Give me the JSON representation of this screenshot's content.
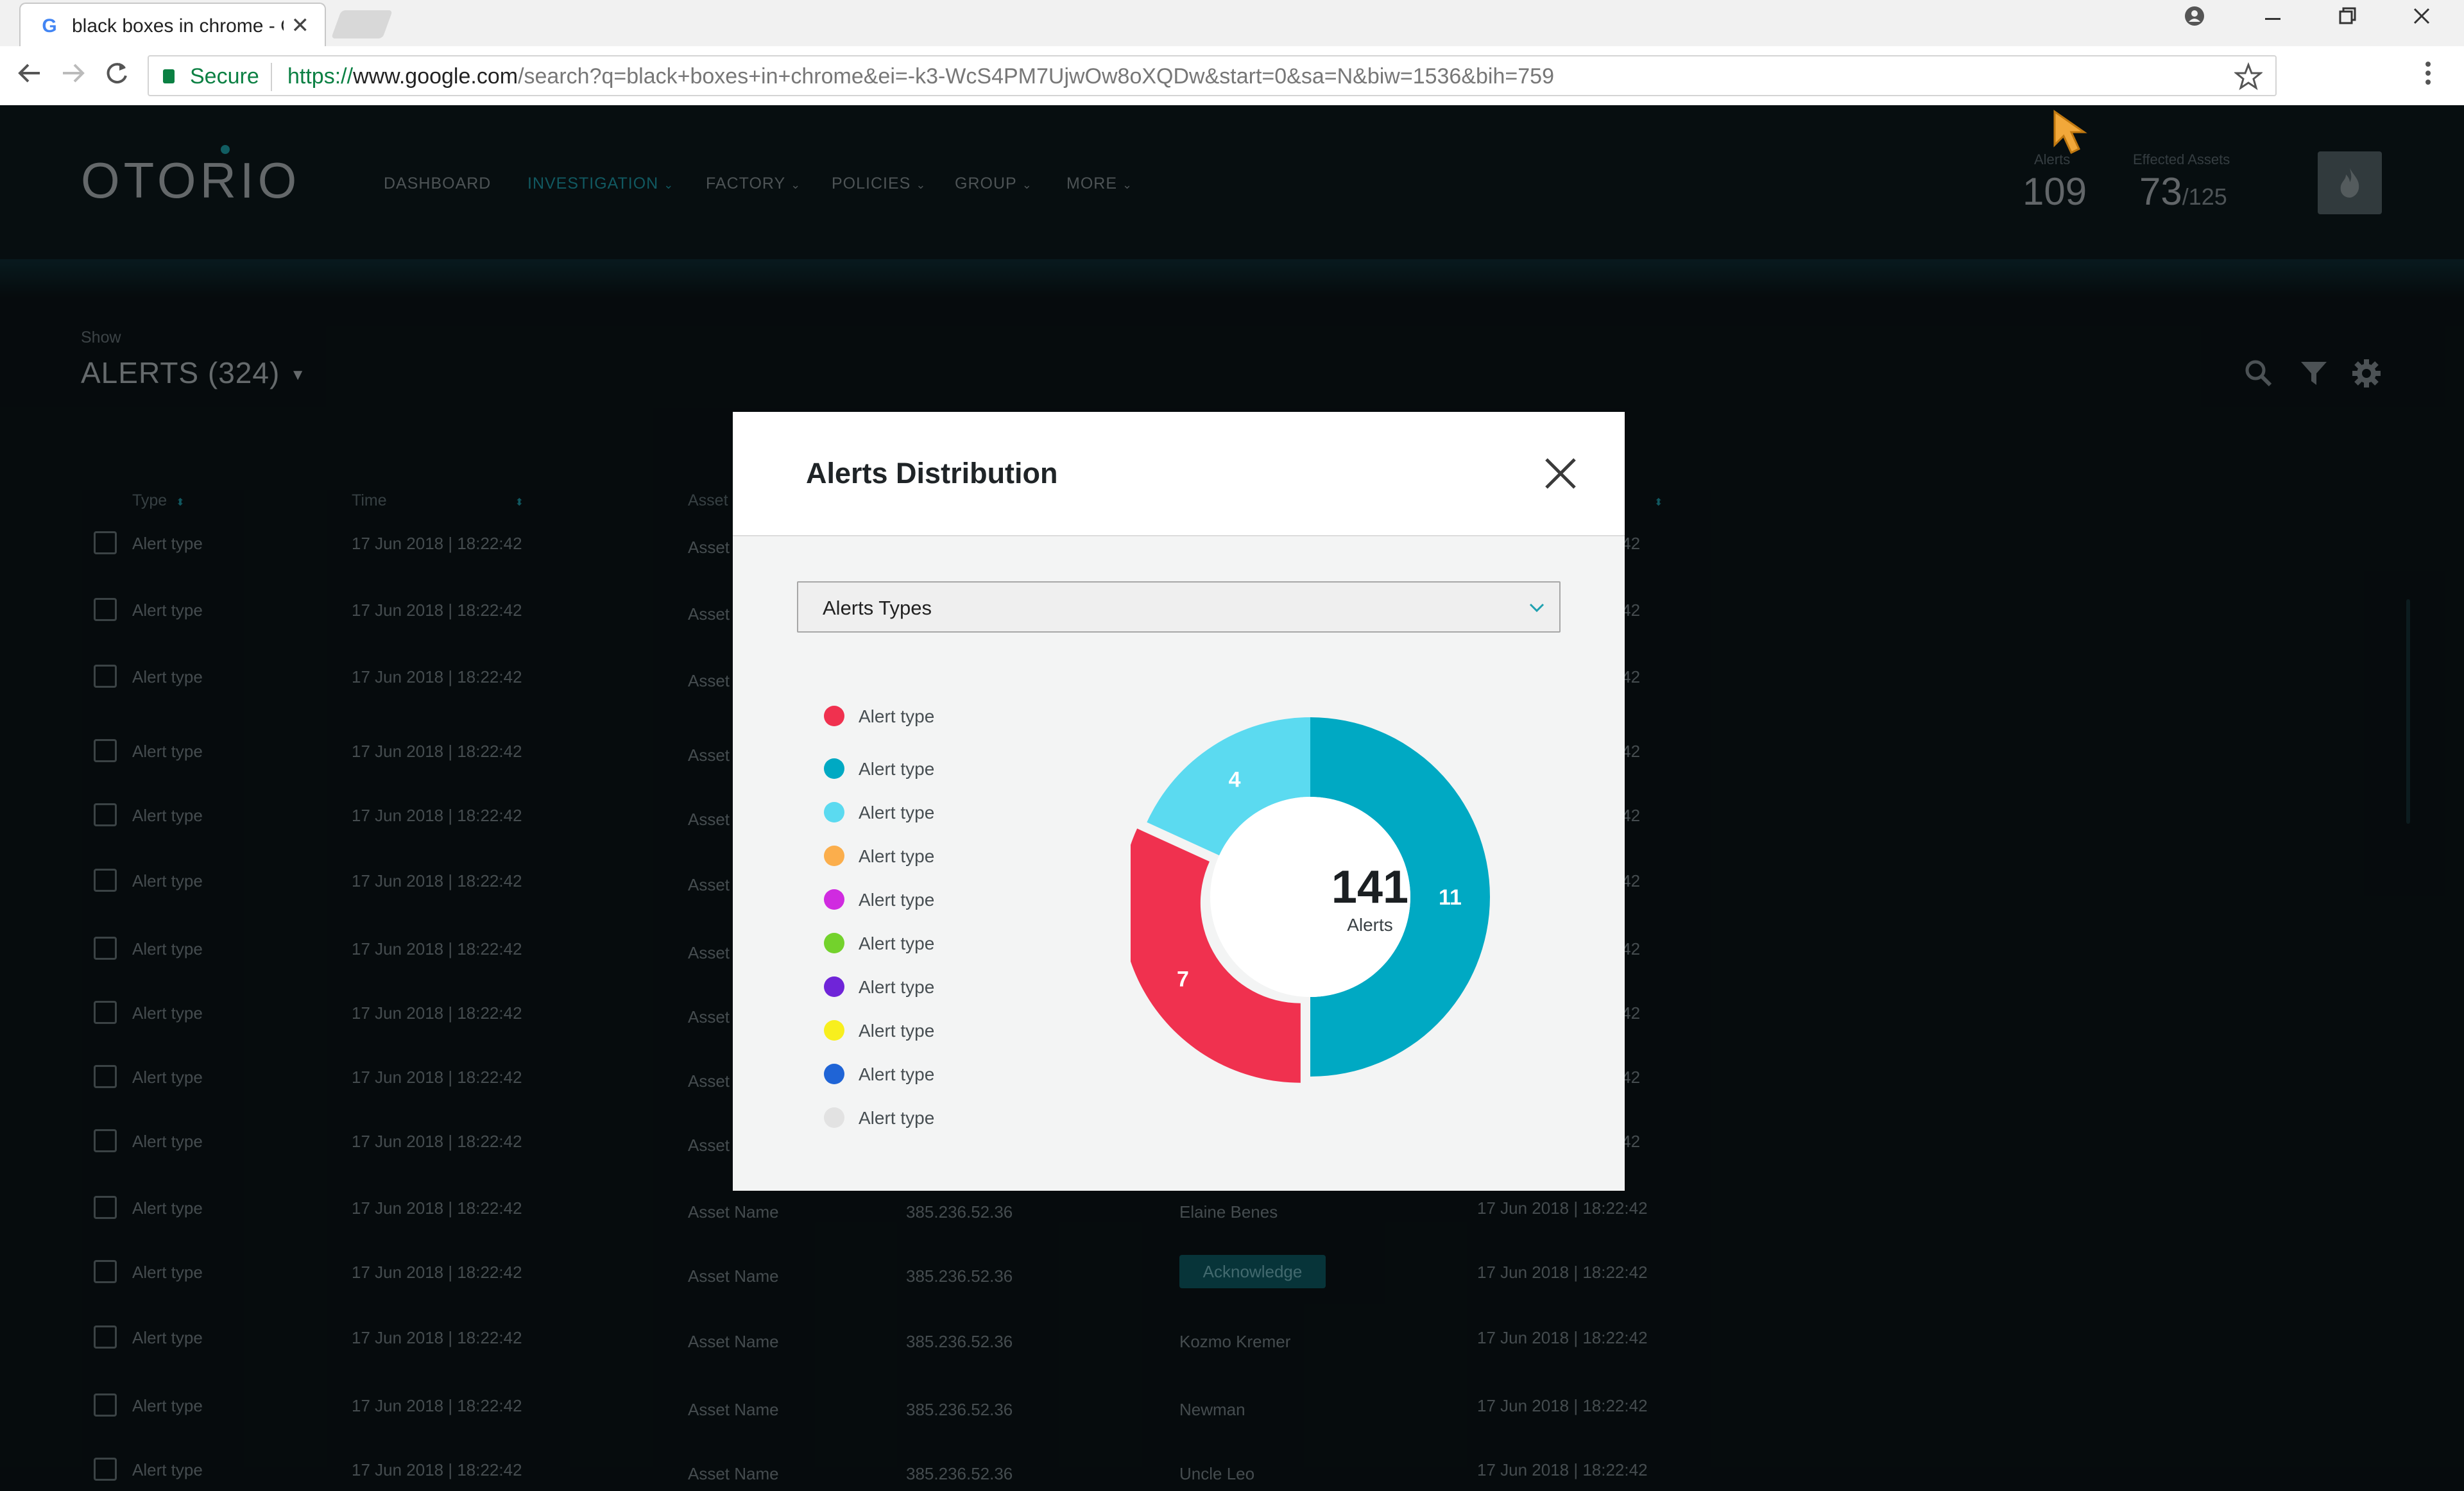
{
  "browser": {
    "tab_title": "black boxes in chrome - G",
    "favicon": "G",
    "tab_close": "✕",
    "secure_label": "Secure",
    "url_https": "https://",
    "url_domain": "www.google.com",
    "url_path": "/search?q=black+boxes+in+chrome&ei=-k3-WcS4PM7UjwOw8oXQDw&start=0&sa=N&biw=1536&bih=759",
    "icons": [
      "back-icon",
      "forward-icon",
      "reload-icon",
      "lock-icon",
      "star-icon",
      "menu-icon",
      "account-icon",
      "minimize-icon",
      "restore-icon",
      "close-icon"
    ]
  },
  "header": {
    "logo": "OTORIO",
    "nav": [
      {
        "label": "DASHBOARD",
        "dropdown": false
      },
      {
        "label": "INVESTIGATION",
        "dropdown": true,
        "active": true
      },
      {
        "label": "FACTORY",
        "dropdown": true
      },
      {
        "label": "POLICIES",
        "dropdown": true
      },
      {
        "label": "GROUP",
        "dropdown": true
      },
      {
        "label": "MORE",
        "dropdown": true
      }
    ],
    "stats": {
      "alerts_label": "Alerts",
      "alerts_value": "109",
      "assets_label": "Effected Assets",
      "assets_value": "73",
      "assets_total": "/125"
    },
    "accent_color": "#1fa1b0"
  },
  "content": {
    "show_label": "Show",
    "title": "ALERTS (324)",
    "toolbar_icons": [
      "search-icon",
      "filter-icon",
      "settings-icon"
    ],
    "columns": [
      "Type",
      "Time",
      "Asset"
    ],
    "rows": [
      {
        "type": "Alert type",
        "time": "17 Jun 2018 | 18:22:42",
        "asset": "Asset",
        "ip": "",
        "owner": "",
        "time2": ":42"
      },
      {
        "type": "Alert type",
        "time": "17 Jun 2018 | 18:22:42",
        "asset": "Asset",
        "ip": "",
        "owner": "",
        "time2": ":42"
      },
      {
        "type": "Alert type",
        "time": "17 Jun 2018 | 18:22:42",
        "asset": "Asset",
        "ip": "",
        "owner": "",
        "time2": ":42"
      },
      {
        "type": "Alert type",
        "time": "17 Jun 2018 | 18:22:42",
        "asset": "Asset",
        "ip": "",
        "owner": "",
        "time2": ":42"
      },
      {
        "type": "Alert type",
        "time": "17 Jun 2018 | 18:22:42",
        "asset": "Asset",
        "ip": "",
        "owner": "",
        "time2": ":42"
      },
      {
        "type": "Alert type",
        "time": "17 Jun 2018 | 18:22:42",
        "asset": "Asset",
        "ip": "",
        "owner": "",
        "time2": ":42"
      },
      {
        "type": "Alert type",
        "time": "17 Jun 2018 | 18:22:42",
        "asset": "Asset",
        "ip": "",
        "owner": "",
        "time2": ":42"
      },
      {
        "type": "Alert type",
        "time": "17 Jun 2018 | 18:22:42",
        "asset": "Asset",
        "ip": "",
        "owner": "",
        "time2": ":42"
      },
      {
        "type": "Alert type",
        "time": "17 Jun 2018 | 18:22:42",
        "asset": "Asset",
        "ip": "",
        "owner": "",
        "time2": ":42"
      },
      {
        "type": "Alert type",
        "time": "17 Jun 2018 | 18:22:42",
        "asset": "Asset",
        "ip": "",
        "owner": "",
        "time2": ":42"
      },
      {
        "type": "Alert type",
        "time": "17 Jun 2018 | 18:22:42",
        "asset": "Asset Name",
        "ip": "385.236.52.36",
        "owner": "Elaine Benes",
        "time2": "17 Jun 2018 | 18:22:42"
      },
      {
        "type": "Alert type",
        "time": "17 Jun 2018 | 18:22:42",
        "asset": "Asset Name",
        "ip": "385.236.52.36",
        "owner": "Acknowledge",
        "ack": true,
        "time2": "17 Jun 2018 | 18:22:42"
      },
      {
        "type": "Alert type",
        "time": "17 Jun 2018 | 18:22:42",
        "asset": "Asset Name",
        "ip": "385.236.52.36",
        "owner": "Kozmo Kremer",
        "time2": "17 Jun 2018 | 18:22:42"
      },
      {
        "type": "Alert type",
        "time": "17 Jun 2018 | 18:22:42",
        "asset": "Asset Name",
        "ip": "385.236.52.36",
        "owner": "Newman",
        "time2": "17 Jun 2018 | 18:22:42"
      },
      {
        "type": "Alert type",
        "time": "17 Jun 2018 | 18:22:42",
        "asset": "Asset Name",
        "ip": "385.236.52.36",
        "owner": "Uncle Leo",
        "time2": "17 Jun 2018 | 18:22:42"
      }
    ]
  },
  "modal": {
    "title": "Alerts Distribution",
    "close_icon": "close-icon",
    "select_value": "Alerts Types",
    "legend": [
      {
        "label": "Alert type",
        "color": "#f0314f"
      },
      {
        "label": "Alert type",
        "color": "#00a9c3"
      },
      {
        "label": "Alert type",
        "color": "#5bdaf0"
      },
      {
        "label": "Alert type",
        "color": "#fbae4c"
      },
      {
        "label": "Alert type",
        "color": "#d02be0"
      },
      {
        "label": "Alert type",
        "color": "#73d22c"
      },
      {
        "label": "Alert type",
        "color": "#6f24d8"
      },
      {
        "label": "Alert type",
        "color": "#f8ef1e"
      },
      {
        "label": "Alert type",
        "color": "#1f64d6"
      },
      {
        "label": "Alert type",
        "color": "#e2e2e2"
      }
    ],
    "center_value": "141",
    "center_label": "Alerts"
  },
  "chart_data": {
    "type": "pie",
    "variant": "donut",
    "categories": [
      "Alert type",
      "Alert type",
      "Alert type"
    ],
    "values": [
      11,
      7,
      4
    ],
    "value_labels": [
      "11",
      "7",
      "4"
    ],
    "colors": [
      "#00a9c3",
      "#f0314f",
      "#5bdaf0"
    ],
    "exploded": [
      false,
      true,
      false
    ],
    "start_angle_deg": 0,
    "direction": "clockwise"
  }
}
